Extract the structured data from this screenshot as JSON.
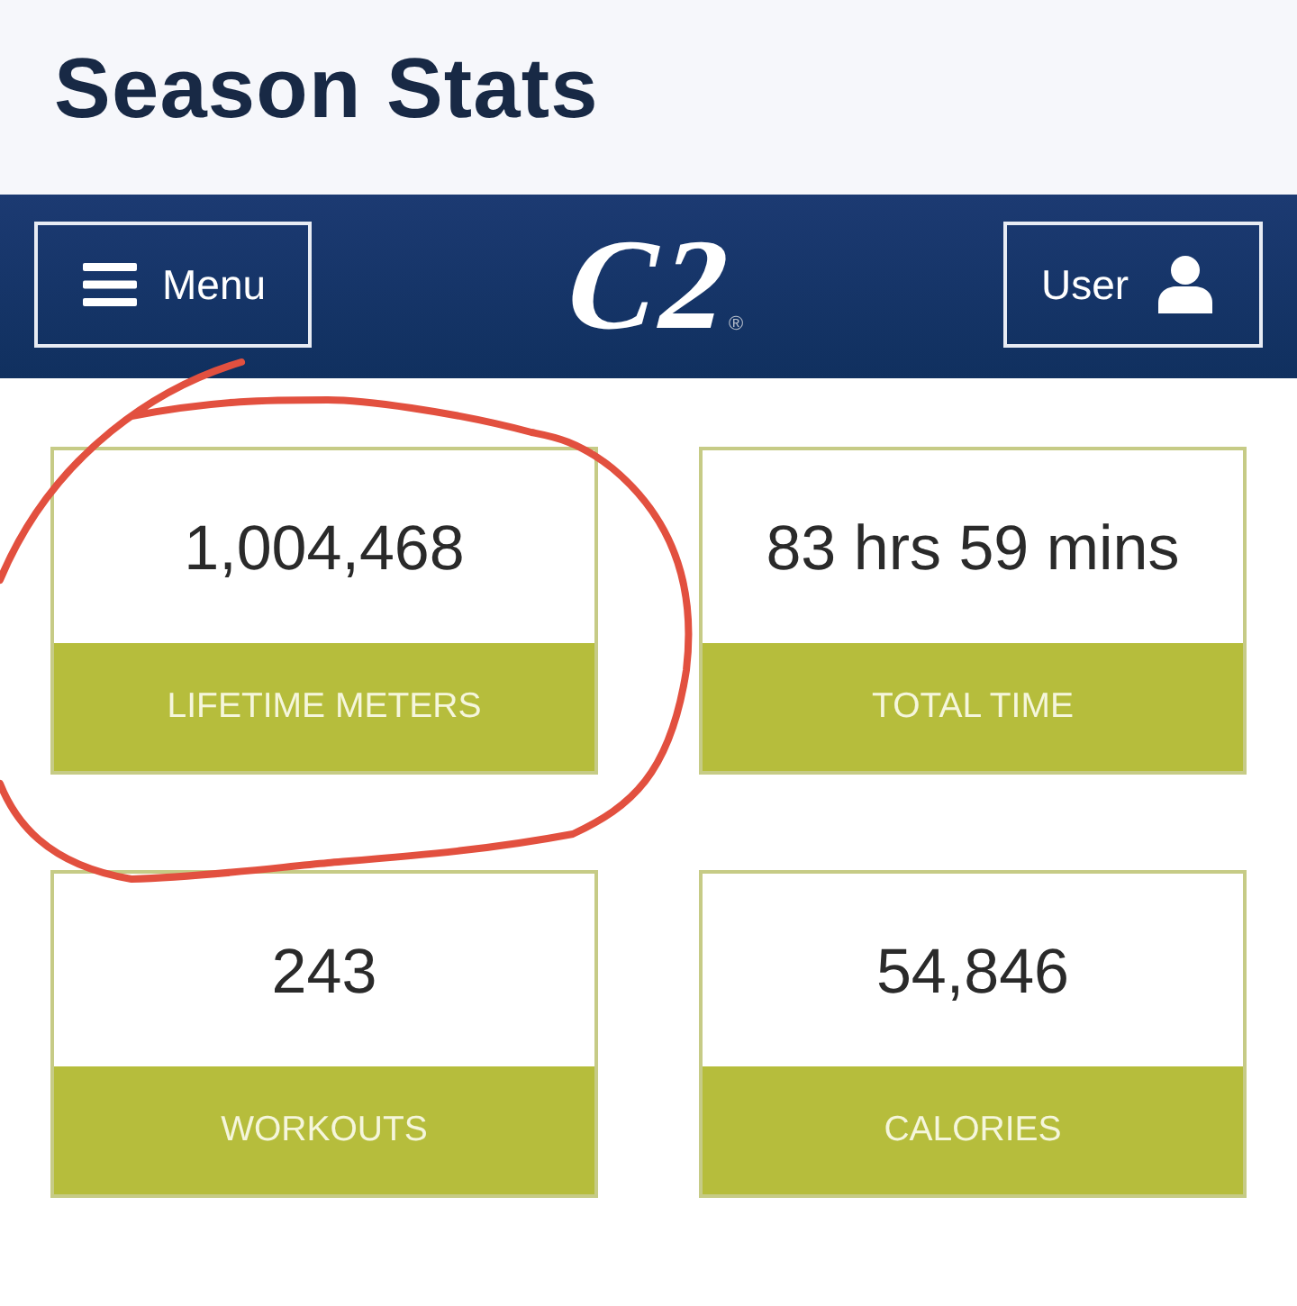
{
  "header": {
    "title": "Season Stats"
  },
  "navbar": {
    "menu_button": {
      "label": "Menu"
    },
    "logo": {
      "text": "C2",
      "mark": "®"
    },
    "user_button": {
      "label": "User"
    }
  },
  "cards": [
    {
      "value": "1,004,468",
      "label": "LIFETIME METERS",
      "circled": true
    },
    {
      "value": "83 hrs 59 mins",
      "label": "TOTAL TIME",
      "circled": false
    },
    {
      "value": "243",
      "label": "WORKOUTS",
      "circled": false
    },
    {
      "value": "54,846",
      "label": "CALORIES",
      "circled": false
    }
  ]
}
